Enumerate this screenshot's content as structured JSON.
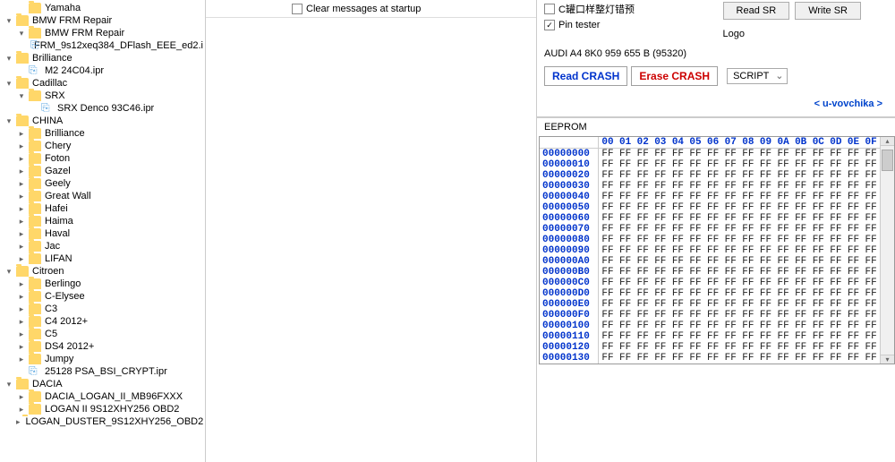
{
  "tree": [
    {
      "indent": 1,
      "type": "folder",
      "toggle": "",
      "label": "Yamaha"
    },
    {
      "indent": 0,
      "type": "folder",
      "toggle": "▾",
      "label": "BMW FRM Repair"
    },
    {
      "indent": 1,
      "type": "folder",
      "toggle": "▾",
      "label": "BMW FRM Repair"
    },
    {
      "indent": 2,
      "type": "file",
      "toggle": "",
      "label": "FRM_9s12xeq384_DFlash_EEE_ed2.i"
    },
    {
      "indent": 0,
      "type": "folder",
      "toggle": "▾",
      "label": "Brilliance"
    },
    {
      "indent": 1,
      "type": "file",
      "toggle": "",
      "label": "M2  24C04.ipr"
    },
    {
      "indent": 0,
      "type": "folder",
      "toggle": "▾",
      "label": "Cadillac"
    },
    {
      "indent": 1,
      "type": "folder",
      "toggle": "▾",
      "label": "SRX"
    },
    {
      "indent": 2,
      "type": "file",
      "toggle": "",
      "label": "SRX  Denco  93C46.ipr"
    },
    {
      "indent": 0,
      "type": "folder",
      "toggle": "▾",
      "label": "CHINA"
    },
    {
      "indent": 1,
      "type": "folder",
      "toggle": "▸",
      "label": "Brilliance"
    },
    {
      "indent": 1,
      "type": "folder",
      "toggle": "▸",
      "label": "Chery"
    },
    {
      "indent": 1,
      "type": "folder",
      "toggle": "▸",
      "label": "Foton"
    },
    {
      "indent": 1,
      "type": "folder",
      "toggle": "▸",
      "label": "Gazel"
    },
    {
      "indent": 1,
      "type": "folder",
      "toggle": "▸",
      "label": "Geely"
    },
    {
      "indent": 1,
      "type": "folder",
      "toggle": "▸",
      "label": "Great Wall"
    },
    {
      "indent": 1,
      "type": "folder",
      "toggle": "▸",
      "label": "Hafei"
    },
    {
      "indent": 1,
      "type": "folder",
      "toggle": "▸",
      "label": "Haima"
    },
    {
      "indent": 1,
      "type": "folder",
      "toggle": "▸",
      "label": "Haval"
    },
    {
      "indent": 1,
      "type": "folder",
      "toggle": "▸",
      "label": "Jac"
    },
    {
      "indent": 1,
      "type": "folder",
      "toggle": "▸",
      "label": "LIFAN"
    },
    {
      "indent": 0,
      "type": "folder",
      "toggle": "▾",
      "label": "Citroen"
    },
    {
      "indent": 1,
      "type": "folder",
      "toggle": "▸",
      "label": "Berlingo"
    },
    {
      "indent": 1,
      "type": "folder",
      "toggle": "▸",
      "label": "C-Elysee"
    },
    {
      "indent": 1,
      "type": "folder",
      "toggle": "▸",
      "label": "C3"
    },
    {
      "indent": 1,
      "type": "folder",
      "toggle": "▸",
      "label": "C4 2012+"
    },
    {
      "indent": 1,
      "type": "folder",
      "toggle": "▸",
      "label": "C5"
    },
    {
      "indent": 1,
      "type": "folder",
      "toggle": "▸",
      "label": "DS4 2012+"
    },
    {
      "indent": 1,
      "type": "folder",
      "toggle": "▸",
      "label": "Jumpy"
    },
    {
      "indent": 1,
      "type": "file",
      "toggle": "",
      "label": "25128 PSA_BSI_CRYPT.ipr"
    },
    {
      "indent": 0,
      "type": "folder",
      "toggle": "▾",
      "label": "DACIA"
    },
    {
      "indent": 1,
      "type": "folder",
      "toggle": "▸",
      "label": "DACIA_LOGAN_II_MB96FXXX"
    },
    {
      "indent": 1,
      "type": "folder",
      "toggle": "▸",
      "label": "LOGAN II 9S12XHY256 OBD2"
    },
    {
      "indent": 1,
      "type": "folder",
      "toggle": "▸",
      "label": "LOGAN_DUSTER_9S12XHY256_OBD2"
    }
  ],
  "middle": {
    "clear_label": "Clear messages at startup"
  },
  "right": {
    "opt1_label": "C罐口样整灯错预",
    "opt2_label": "Pin tester",
    "read_sr": "Read SR",
    "write_sr": "Write SR",
    "logo": "Logo",
    "info": "AUDI  A4   8K0 959 655 B  (95320)",
    "read_crash": "Read CRASH",
    "erase_crash": "Erase CRASH",
    "script": "SCRIPT",
    "link": "< u-vovchika >",
    "eeprom_label": "EEPROM"
  },
  "hex": {
    "cols": [
      "00",
      "01",
      "02",
      "03",
      "04",
      "05",
      "06",
      "07",
      "08",
      "09",
      "0A",
      "0B",
      "0C",
      "0D",
      "0E",
      "0F"
    ],
    "rows": [
      {
        "addr": "00000000",
        "vals": [
          "FF",
          "FF",
          "FF",
          "FF",
          "FF",
          "FF",
          "FF",
          "FF",
          "FF",
          "FF",
          "FF",
          "FF",
          "FF",
          "FF",
          "FF",
          "FF"
        ]
      },
      {
        "addr": "00000010",
        "vals": [
          "FF",
          "FF",
          "FF",
          "FF",
          "FF",
          "FF",
          "FF",
          "FF",
          "FF",
          "FF",
          "FF",
          "FF",
          "FF",
          "FF",
          "FF",
          "FF"
        ]
      },
      {
        "addr": "00000020",
        "vals": [
          "FF",
          "FF",
          "FF",
          "FF",
          "FF",
          "FF",
          "FF",
          "FF",
          "FF",
          "FF",
          "FF",
          "FF",
          "FF",
          "FF",
          "FF",
          "FF"
        ]
      },
      {
        "addr": "00000030",
        "vals": [
          "FF",
          "FF",
          "FF",
          "FF",
          "FF",
          "FF",
          "FF",
          "FF",
          "FF",
          "FF",
          "FF",
          "FF",
          "FF",
          "FF",
          "FF",
          "FF"
        ]
      },
      {
        "addr": "00000040",
        "vals": [
          "FF",
          "FF",
          "FF",
          "FF",
          "FF",
          "FF",
          "FF",
          "FF",
          "FF",
          "FF",
          "FF",
          "FF",
          "FF",
          "FF",
          "FF",
          "FF"
        ]
      },
      {
        "addr": "00000050",
        "vals": [
          "FF",
          "FF",
          "FF",
          "FF",
          "FF",
          "FF",
          "FF",
          "FF",
          "FF",
          "FF",
          "FF",
          "FF",
          "FF",
          "FF",
          "FF",
          "FF"
        ]
      },
      {
        "addr": "00000060",
        "vals": [
          "FF",
          "FF",
          "FF",
          "FF",
          "FF",
          "FF",
          "FF",
          "FF",
          "FF",
          "FF",
          "FF",
          "FF",
          "FF",
          "FF",
          "FF",
          "FF"
        ]
      },
      {
        "addr": "00000070",
        "vals": [
          "FF",
          "FF",
          "FF",
          "FF",
          "FF",
          "FF",
          "FF",
          "FF",
          "FF",
          "FF",
          "FF",
          "FF",
          "FF",
          "FF",
          "FF",
          "FF"
        ]
      },
      {
        "addr": "00000080",
        "vals": [
          "FF",
          "FF",
          "FF",
          "FF",
          "FF",
          "FF",
          "FF",
          "FF",
          "FF",
          "FF",
          "FF",
          "FF",
          "FF",
          "FF",
          "FF",
          "FF"
        ]
      },
      {
        "addr": "00000090",
        "vals": [
          "FF",
          "FF",
          "FF",
          "FF",
          "FF",
          "FF",
          "FF",
          "FF",
          "FF",
          "FF",
          "FF",
          "FF",
          "FF",
          "FF",
          "FF",
          "FF"
        ]
      },
      {
        "addr": "000000A0",
        "vals": [
          "FF",
          "FF",
          "FF",
          "FF",
          "FF",
          "FF",
          "FF",
          "FF",
          "FF",
          "FF",
          "FF",
          "FF",
          "FF",
          "FF",
          "FF",
          "FF"
        ]
      },
      {
        "addr": "000000B0",
        "vals": [
          "FF",
          "FF",
          "FF",
          "FF",
          "FF",
          "FF",
          "FF",
          "FF",
          "FF",
          "FF",
          "FF",
          "FF",
          "FF",
          "FF",
          "FF",
          "FF"
        ]
      },
      {
        "addr": "000000C0",
        "vals": [
          "FF",
          "FF",
          "FF",
          "FF",
          "FF",
          "FF",
          "FF",
          "FF",
          "FF",
          "FF",
          "FF",
          "FF",
          "FF",
          "FF",
          "FF",
          "FF"
        ]
      },
      {
        "addr": "000000D0",
        "vals": [
          "FF",
          "FF",
          "FF",
          "FF",
          "FF",
          "FF",
          "FF",
          "FF",
          "FF",
          "FF",
          "FF",
          "FF",
          "FF",
          "FF",
          "FF",
          "FF"
        ]
      },
      {
        "addr": "000000E0",
        "vals": [
          "FF",
          "FF",
          "FF",
          "FF",
          "FF",
          "FF",
          "FF",
          "FF",
          "FF",
          "FF",
          "FF",
          "FF",
          "FF",
          "FF",
          "FF",
          "FF"
        ]
      },
      {
        "addr": "000000F0",
        "vals": [
          "FF",
          "FF",
          "FF",
          "FF",
          "FF",
          "FF",
          "FF",
          "FF",
          "FF",
          "FF",
          "FF",
          "FF",
          "FF",
          "FF",
          "FF",
          "FF"
        ]
      },
      {
        "addr": "00000100",
        "vals": [
          "FF",
          "FF",
          "FF",
          "FF",
          "FF",
          "FF",
          "FF",
          "FF",
          "FF",
          "FF",
          "FF",
          "FF",
          "FF",
          "FF",
          "FF",
          "FF"
        ]
      },
      {
        "addr": "00000110",
        "vals": [
          "FF",
          "FF",
          "FF",
          "FF",
          "FF",
          "FF",
          "FF",
          "FF",
          "FF",
          "FF",
          "FF",
          "FF",
          "FF",
          "FF",
          "FF",
          "FF"
        ]
      },
      {
        "addr": "00000120",
        "vals": [
          "FF",
          "FF",
          "FF",
          "FF",
          "FF",
          "FF",
          "FF",
          "FF",
          "FF",
          "FF",
          "FF",
          "FF",
          "FF",
          "FF",
          "FF",
          "FF"
        ]
      },
      {
        "addr": "00000130",
        "vals": [
          "FF",
          "FF",
          "FF",
          "FF",
          "FF",
          "FF",
          "FF",
          "FF",
          "FF",
          "FF",
          "FF",
          "FF",
          "FF",
          "FF",
          "FF",
          "FF"
        ]
      }
    ]
  }
}
